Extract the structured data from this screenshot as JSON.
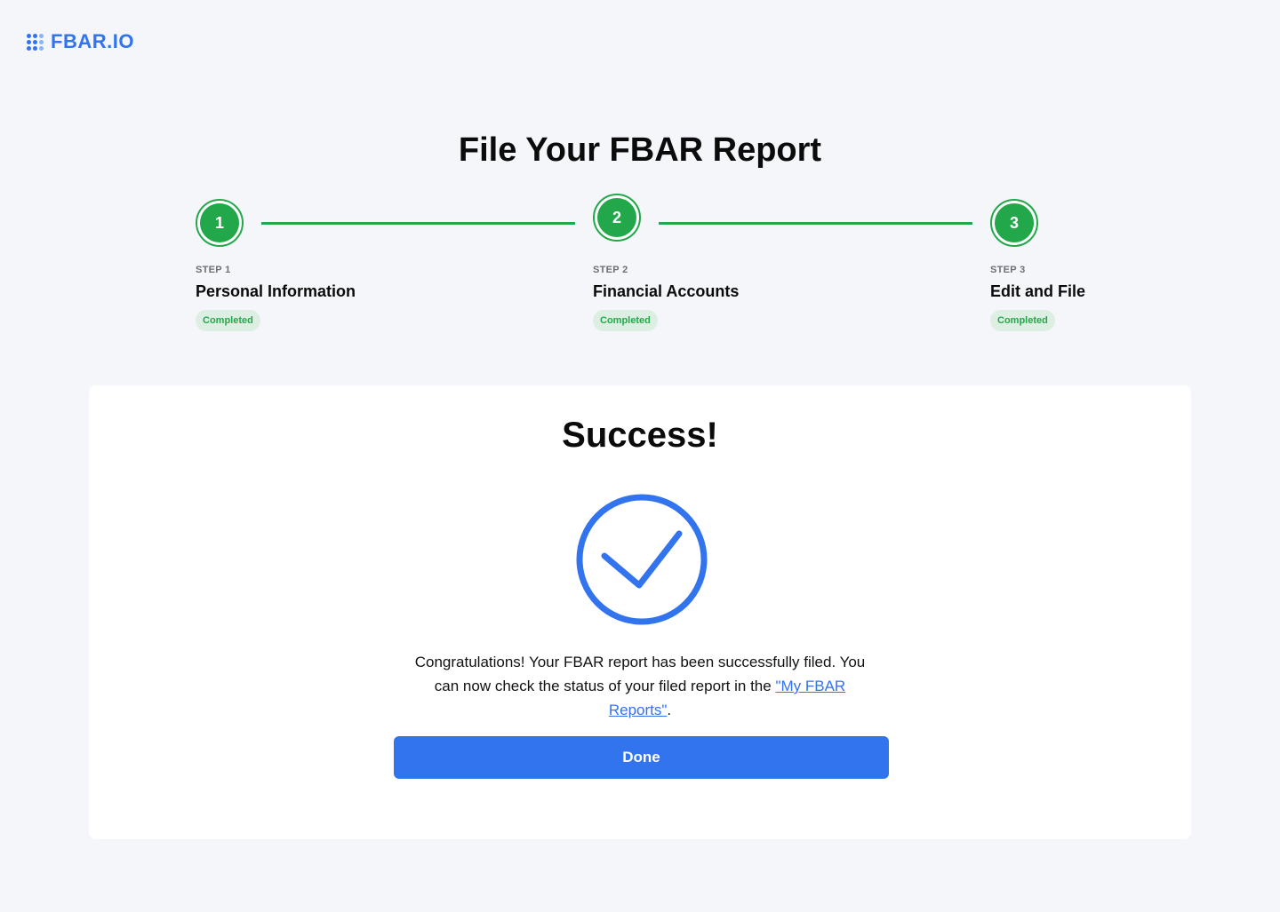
{
  "logo": {
    "text": "FBAR.IO"
  },
  "header": {
    "title": "File Your FBAR Report"
  },
  "steps": [
    {
      "number": "1",
      "kicker": "STEP 1",
      "title": "Personal Information",
      "status": "Completed"
    },
    {
      "number": "2",
      "kicker": "STEP 2",
      "title": "Financial Accounts",
      "status": "Completed"
    },
    {
      "number": "3",
      "kicker": "STEP 3",
      "title": "Edit and File",
      "status": "Completed"
    }
  ],
  "card": {
    "title": "Success!",
    "message_before": "Congratulations! Your FBAR report has been successfully filed. You can now check the status of your filed report in the ",
    "link_text": "\"My FBAR Reports\"",
    "message_after": ".",
    "done_label": "Done"
  },
  "colors": {
    "brand": "#3273ee",
    "success": "#22a84a",
    "success_bg": "#dcefe2",
    "page_bg": "#f4f6fa"
  },
  "icons": {
    "success": "check-circle-icon",
    "logo": "dots-grid-icon"
  }
}
